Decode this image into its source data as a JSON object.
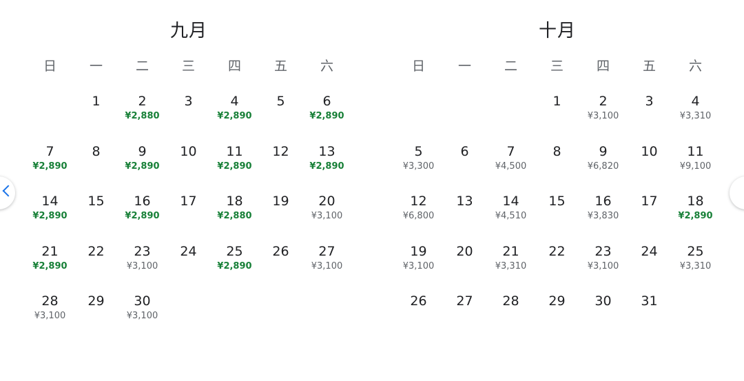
{
  "months": [
    {
      "title": "九月",
      "weekdays": [
        "日",
        "一",
        "二",
        "三",
        "四",
        "五",
        "六"
      ],
      "lead": 1,
      "days": [
        {
          "d": "1",
          "p": ""
        },
        {
          "d": "2",
          "p": "¥2,880",
          "low": true
        },
        {
          "d": "3",
          "p": ""
        },
        {
          "d": "4",
          "p": "¥2,890",
          "low": true
        },
        {
          "d": "5",
          "p": ""
        },
        {
          "d": "6",
          "p": "¥2,890",
          "low": true
        },
        {
          "d": "7",
          "p": "¥2,890",
          "low": true
        },
        {
          "d": "8",
          "p": ""
        },
        {
          "d": "9",
          "p": "¥2,890",
          "low": true
        },
        {
          "d": "10",
          "p": ""
        },
        {
          "d": "11",
          "p": "¥2,890",
          "low": true
        },
        {
          "d": "12",
          "p": ""
        },
        {
          "d": "13",
          "p": "¥2,890",
          "low": true
        },
        {
          "d": "14",
          "p": "¥2,890",
          "low": true
        },
        {
          "d": "15",
          "p": ""
        },
        {
          "d": "16",
          "p": "¥2,890",
          "low": true
        },
        {
          "d": "17",
          "p": ""
        },
        {
          "d": "18",
          "p": "¥2,880",
          "low": true
        },
        {
          "d": "19",
          "p": ""
        },
        {
          "d": "20",
          "p": "¥3,100"
        },
        {
          "d": "21",
          "p": "¥2,890",
          "low": true
        },
        {
          "d": "22",
          "p": ""
        },
        {
          "d": "23",
          "p": "¥3,100"
        },
        {
          "d": "24",
          "p": ""
        },
        {
          "d": "25",
          "p": "¥2,890",
          "low": true
        },
        {
          "d": "26",
          "p": ""
        },
        {
          "d": "27",
          "p": "¥3,100"
        },
        {
          "d": "28",
          "p": "¥3,100"
        },
        {
          "d": "29",
          "p": ""
        },
        {
          "d": "30",
          "p": "¥3,100"
        }
      ]
    },
    {
      "title": "十月",
      "weekdays": [
        "日",
        "一",
        "二",
        "三",
        "四",
        "五",
        "六"
      ],
      "lead": 3,
      "days": [
        {
          "d": "1",
          "p": ""
        },
        {
          "d": "2",
          "p": "¥3,100"
        },
        {
          "d": "3",
          "p": ""
        },
        {
          "d": "4",
          "p": "¥3,310"
        },
        {
          "d": "5",
          "p": "¥3,300"
        },
        {
          "d": "6",
          "p": ""
        },
        {
          "d": "7",
          "p": "¥4,500"
        },
        {
          "d": "8",
          "p": ""
        },
        {
          "d": "9",
          "p": "¥6,820"
        },
        {
          "d": "10",
          "p": ""
        },
        {
          "d": "11",
          "p": "¥9,100"
        },
        {
          "d": "12",
          "p": "¥6,800"
        },
        {
          "d": "13",
          "p": ""
        },
        {
          "d": "14",
          "p": "¥4,510"
        },
        {
          "d": "15",
          "p": ""
        },
        {
          "d": "16",
          "p": "¥3,830"
        },
        {
          "d": "17",
          "p": ""
        },
        {
          "d": "18",
          "p": "¥2,890",
          "low": true
        },
        {
          "d": "19",
          "p": "¥3,100"
        },
        {
          "d": "20",
          "p": ""
        },
        {
          "d": "21",
          "p": "¥3,310"
        },
        {
          "d": "22",
          "p": ""
        },
        {
          "d": "23",
          "p": "¥3,100"
        },
        {
          "d": "24",
          "p": ""
        },
        {
          "d": "25",
          "p": "¥3,310"
        },
        {
          "d": "26",
          "p": ""
        },
        {
          "d": "27",
          "p": ""
        },
        {
          "d": "28",
          "p": ""
        },
        {
          "d": "29",
          "p": ""
        },
        {
          "d": "30",
          "p": ""
        },
        {
          "d": "31",
          "p": ""
        }
      ]
    }
  ],
  "colors": {
    "low_price": "#188038",
    "normal_price": "#5f6368",
    "nav_icon": "#1a73e8"
  },
  "icons": {
    "prev": "chevron-left-icon",
    "next": "chevron-right-icon"
  }
}
